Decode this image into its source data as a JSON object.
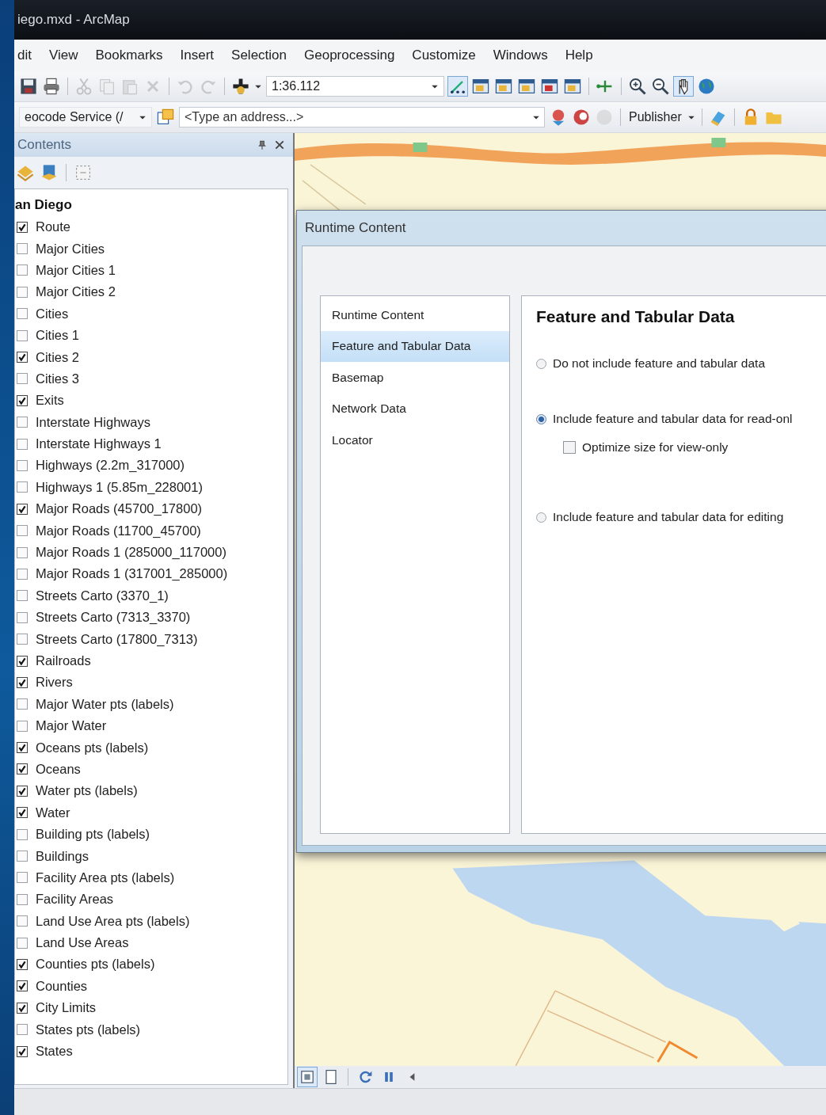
{
  "window": {
    "title": "iego.mxd - ArcMap"
  },
  "menu": [
    "dit",
    "View",
    "Bookmarks",
    "Insert",
    "Selection",
    "Geoprocessing",
    "Customize",
    "Windows",
    "Help"
  ],
  "toolbar": {
    "scale": "1:36.112",
    "geocoder": "eocode Service (/",
    "address": {
      "placeholder": "<Type an address...>"
    },
    "publisher": "Publisher"
  },
  "contents": {
    "title": "Contents",
    "tree": {
      "label": "an Diego",
      "children": [
        {
          "label": "Route",
          "checked": true
        },
        {
          "label": "Major Cities",
          "checked": false
        },
        {
          "label": "Major Cities 1",
          "checked": false
        },
        {
          "label": "Major Cities 2",
          "checked": false
        },
        {
          "label": "Cities",
          "checked": false
        },
        {
          "label": "Cities 1",
          "checked": false
        },
        {
          "label": "Cities 2",
          "checked": true
        },
        {
          "label": "Cities 3",
          "checked": false
        },
        {
          "label": "Exits",
          "checked": true
        },
        {
          "label": "Interstate Highways",
          "checked": false
        },
        {
          "label": "Interstate Highways 1",
          "checked": false
        },
        {
          "label": "Highways (2.2m_317000)",
          "checked": false
        },
        {
          "label": "Highways 1 (5.85m_228001)",
          "checked": false
        },
        {
          "label": "Major Roads (45700_17800)",
          "checked": true
        },
        {
          "label": "Major Roads (11700_45700)",
          "checked": false
        },
        {
          "label": "Major Roads 1 (285000_117000)",
          "checked": false
        },
        {
          "label": "Major Roads 1 (317001_285000)",
          "checked": false
        },
        {
          "label": "Streets Carto (3370_1)",
          "checked": false
        },
        {
          "label": "Streets Carto (7313_3370)",
          "checked": false
        },
        {
          "label": "Streets Carto  (17800_7313)",
          "checked": false
        },
        {
          "label": "Railroads",
          "checked": true
        },
        {
          "label": "Rivers",
          "checked": true
        },
        {
          "label": "Major Water pts (labels)",
          "checked": false
        },
        {
          "label": "Major Water",
          "checked": false
        },
        {
          "label": "Oceans pts (labels)",
          "checked": true
        },
        {
          "label": "Oceans",
          "checked": true
        },
        {
          "label": "Water pts (labels)",
          "checked": true
        },
        {
          "label": "Water",
          "checked": true
        },
        {
          "label": "Building pts (labels)",
          "checked": false
        },
        {
          "label": "Buildings",
          "checked": false
        },
        {
          "label": "Facility Area pts (labels)",
          "checked": false
        },
        {
          "label": "Facility Areas",
          "checked": false
        },
        {
          "label": "Land Use Area pts (labels)",
          "checked": false
        },
        {
          "label": "Land Use Areas",
          "checked": false
        },
        {
          "label": "Counties pts (labels)",
          "checked": true
        },
        {
          "label": "Counties",
          "checked": true
        },
        {
          "label": "City Limits",
          "checked": true
        },
        {
          "label": "States pts (labels)",
          "checked": false
        },
        {
          "label": "States",
          "checked": true
        }
      ]
    }
  },
  "dialog": {
    "title": "Runtime Content",
    "nav": [
      {
        "label": "Runtime Content",
        "selected": false
      },
      {
        "label": "Feature and Tabular Data",
        "selected": true
      },
      {
        "label": "Basemap",
        "selected": false
      },
      {
        "label": "Network Data",
        "selected": false
      },
      {
        "label": "Locator",
        "selected": false
      }
    ],
    "heading": "Feature and Tabular Data",
    "options": [
      {
        "label": "Do not include feature and tabular data",
        "selected": false
      },
      {
        "label": "Include feature and tabular data for read-onl",
        "selected": true
      },
      {
        "label": "Include feature and tabular data for editing",
        "selected": false
      }
    ],
    "optimize": {
      "label": "Optimize size for view-only",
      "checked": false
    }
  }
}
